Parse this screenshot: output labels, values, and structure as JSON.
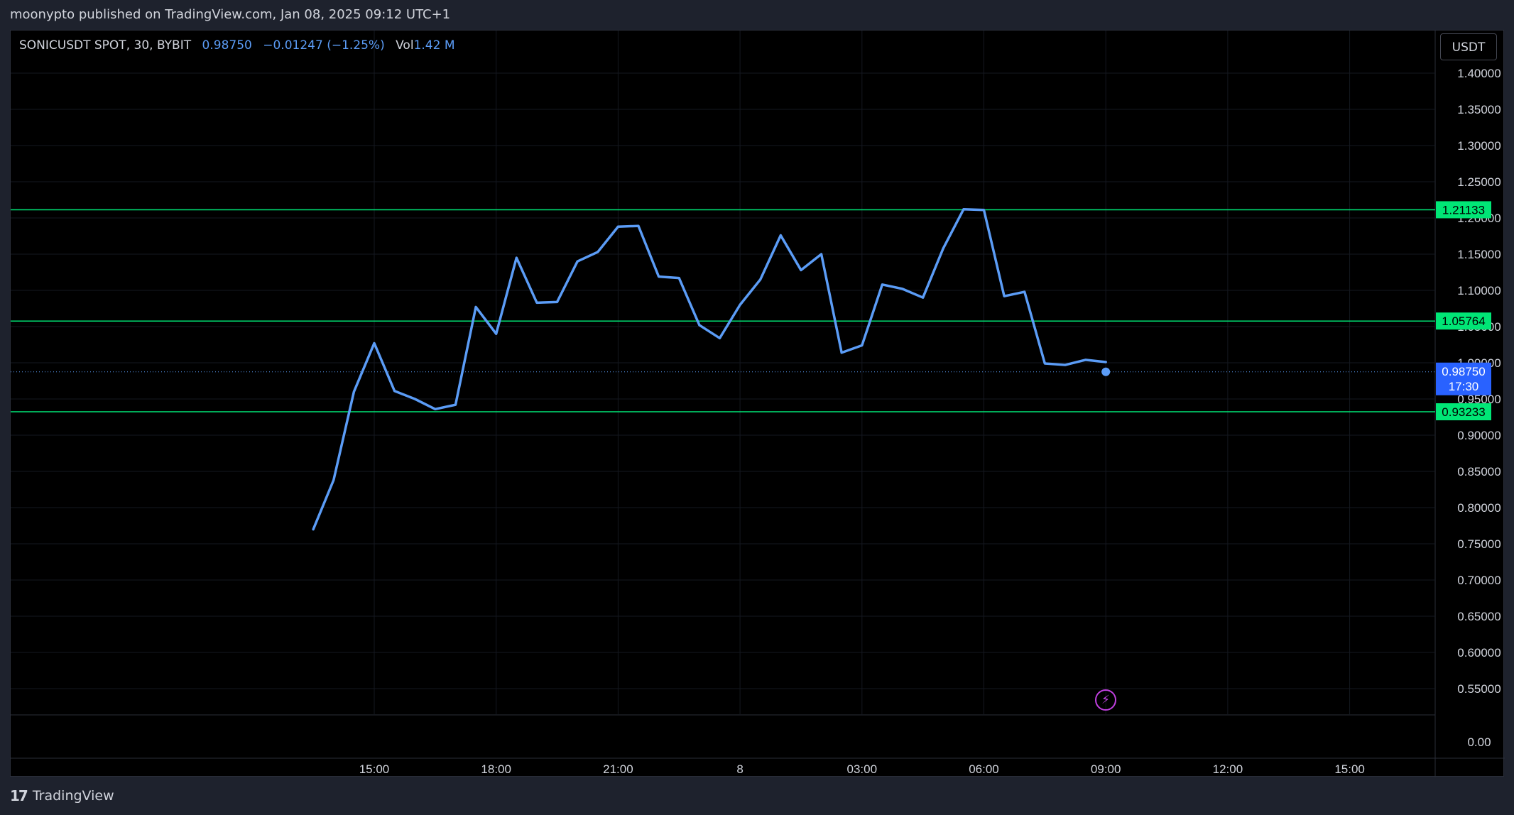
{
  "header": {
    "published": "moonypto published on TradingView.com, Jan 08, 2025 09:12 UTC+1"
  },
  "legend": {
    "symbol": "SONICUSDT SPOT, 30, BYBIT",
    "price": "0.98750",
    "change": "−0.01247 (−1.25%)",
    "vol_label": "Vol",
    "vol_value": "1.42 M"
  },
  "currency": "USDT",
  "footer": {
    "brand": "TradingView",
    "logo_icon": "tradingview-logo-icon"
  },
  "colors": {
    "line": "#5b9cf6",
    "level": "#00e676",
    "background": "#000000",
    "last_price_tag": "#2962ff"
  },
  "chart_data": {
    "type": "line",
    "ylim": [
      0,
      1.42
    ],
    "y_tick_labels": [
      "1.40000",
      "1.35000",
      "1.30000",
      "1.25000",
      "1.20000",
      "1.15000",
      "1.10000",
      "1.05000",
      "1.00000",
      "0.95000",
      "0.90000",
      "0.85000",
      "0.80000",
      "0.75000",
      "0.70000",
      "0.65000",
      "0.60000",
      "0.55000",
      "0.00"
    ],
    "y_tick_values": [
      1.4,
      1.35,
      1.3,
      1.25,
      1.2,
      1.15,
      1.1,
      1.05,
      1.0,
      0.95,
      0.9,
      0.85,
      0.8,
      0.75,
      0.7,
      0.65,
      0.6,
      0.55,
      0.0
    ],
    "x_tick_labels": [
      "15:00",
      "18:00",
      "21:00",
      "8",
      "03:00",
      "06:00",
      "09:00",
      "12:00",
      "15:00"
    ],
    "x_tick_hours": [
      15,
      18,
      21,
      24,
      27,
      30,
      33,
      36,
      39
    ],
    "x_hours": [
      13.5,
      14,
      14.5,
      15,
      15.5,
      16,
      16.5,
      17,
      17.5,
      18,
      18.5,
      19,
      19.5,
      20,
      20.5,
      21,
      21.5,
      22,
      22.5,
      23,
      23.5,
      24,
      24.5,
      25,
      25.5,
      26,
      26.5,
      27,
      27.5,
      28,
      28.5,
      29,
      29.5,
      30,
      30.5,
      31,
      31.5,
      32,
      32.5,
      33
    ],
    "values": [
      0.77,
      0.838,
      0.96,
      1.027,
      0.961,
      0.95,
      0.936,
      0.942,
      1.077,
      1.04,
      1.145,
      1.083,
      1.084,
      1.14,
      1.153,
      1.188,
      1.189,
      1.119,
      1.117,
      1.052,
      1.034,
      1.08,
      1.115,
      1.176,
      1.128,
      1.15,
      1.014,
      1.024,
      1.108,
      1.102,
      1.09,
      1.158,
      1.212,
      1.211,
      1.092,
      1.098,
      0.999,
      0.997,
      1.004,
      1.001,
      0.9875
    ],
    "levels": [
      {
        "value": 1.21133,
        "label": "1.21133"
      },
      {
        "value": 1.05764,
        "label": "1.05764"
      },
      {
        "value": 0.93233,
        "label": "0.93233"
      }
    ],
    "last_price": {
      "value": 0.9875,
      "label": "0.98750",
      "countdown": "17:30"
    },
    "grid": true
  }
}
